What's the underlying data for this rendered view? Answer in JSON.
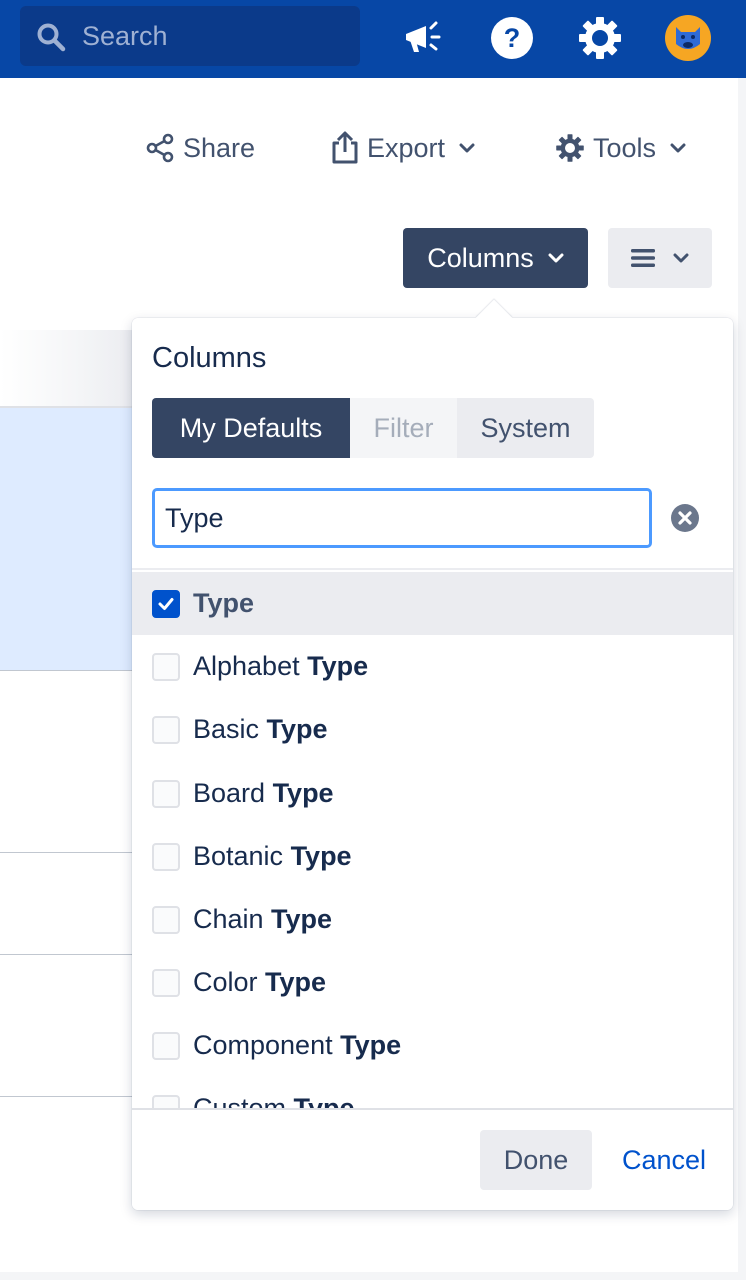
{
  "topbar": {
    "search_placeholder": "Search",
    "icons": [
      "megaphone-icon",
      "help-icon",
      "settings-icon",
      "avatar"
    ],
    "colors": {
      "background": "#0747a6",
      "search_bg": "#0b3a8a"
    }
  },
  "toolbar": {
    "share_label": "Share",
    "export_label": "Export",
    "tools_label": "Tools"
  },
  "view_controls": {
    "columns_label": "Columns",
    "layout_icon": "list-view-icon"
  },
  "columns_popup": {
    "title": "Columns",
    "tabs": [
      {
        "label": "My Defaults",
        "state": "active"
      },
      {
        "label": "Filter",
        "state": "disabled"
      },
      {
        "label": "System",
        "state": "normal"
      }
    ],
    "filter_value": "Type",
    "items": [
      {
        "prefix": "",
        "match": "Type",
        "checked": true
      },
      {
        "prefix": "Alphabet ",
        "match": "Type",
        "checked": false
      },
      {
        "prefix": "Basic ",
        "match": "Type",
        "checked": false
      },
      {
        "prefix": "Board ",
        "match": "Type",
        "checked": false
      },
      {
        "prefix": "Botanic ",
        "match": "Type",
        "checked": false
      },
      {
        "prefix": "Chain ",
        "match": "Type",
        "checked": false
      },
      {
        "prefix": "Color ",
        "match": "Type",
        "checked": false
      },
      {
        "prefix": "Component ",
        "match": "Type",
        "checked": false
      },
      {
        "prefix": "Custom ",
        "match": "Type",
        "checked": false
      }
    ],
    "done_label": "Done",
    "cancel_label": "Cancel",
    "colors": {
      "accent": "#0052cc",
      "active_tab": "#344563",
      "focus_border": "#4c9aff"
    }
  }
}
